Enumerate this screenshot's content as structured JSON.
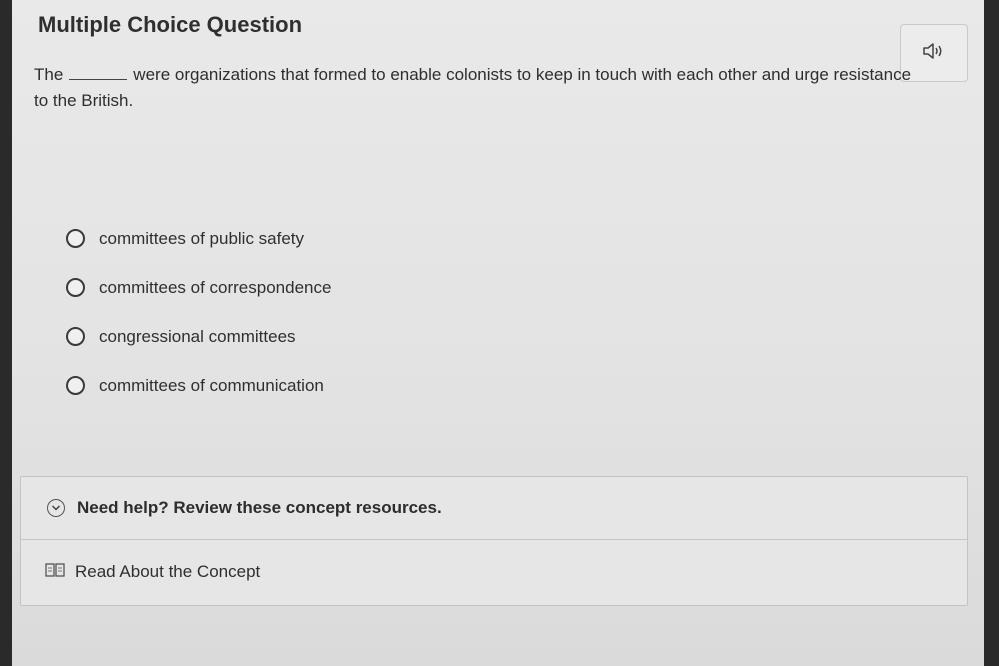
{
  "header": {
    "title": "Multiple Choice Question"
  },
  "audio": {
    "icon": "speaker-icon"
  },
  "question": {
    "before_blank": "The",
    "after_blank": "were organizations that formed to enable colonists to keep in touch with each other and urge resistance to the British."
  },
  "options": [
    {
      "label": "committees of public safety"
    },
    {
      "label": "committees of correspondence"
    },
    {
      "label": "congressional committees"
    },
    {
      "label": "committees of communication"
    }
  ],
  "help": {
    "header": "Need help? Review these concept resources.",
    "link_label": "Read About the Concept",
    "header_icon": "chevron-down-icon",
    "link_icon": "book-icon"
  }
}
